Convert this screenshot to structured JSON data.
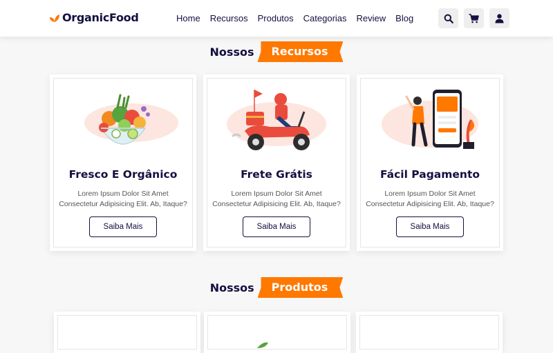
{
  "logo": {
    "text": "OrganicFood"
  },
  "nav": {
    "items": [
      "Home",
      "Recursos",
      "Produtos",
      "Categorias",
      "Review",
      "Blog"
    ]
  },
  "header_icons": [
    "search-icon",
    "cart-icon",
    "user-icon"
  ],
  "features_section": {
    "title_prefix": "Nossos",
    "title_highlight": "Recursos",
    "cards": [
      {
        "title": "Fresco E Orgânico",
        "line1": "Lorem Ipsum Dolor Sit Amet",
        "line2": "Consectetur Adipisicing Elit. Ab, Itaque?",
        "button": "Saiba Mais"
      },
      {
        "title": "Frete Grátis",
        "line1": "Lorem Ipsum Dolor Sit Amet",
        "line2": "Consectetur Adipisicing Elit. Ab, Itaque?",
        "button": "Saiba Mais"
      },
      {
        "title": "Fácil Pagamento",
        "line1": "Lorem Ipsum Dolor Sit Amet",
        "line2": "Consectetur Adipisicing Elit. Ab, Itaque?",
        "button": "Saiba Mais"
      }
    ]
  },
  "products_section": {
    "title_prefix": "Nossos",
    "title_highlight": "Produtos"
  },
  "colors": {
    "accent": "#ff7800",
    "dark": "#130f40"
  }
}
